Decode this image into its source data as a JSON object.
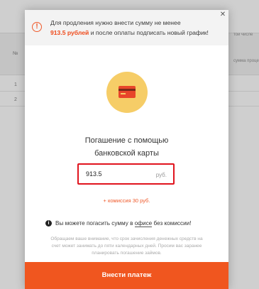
{
  "background": {
    "table_col_no": "№",
    "rows": [
      "1",
      "2"
    ],
    "col_text_1": "той числе",
    "col_text_2": "сумма процентов"
  },
  "notice": {
    "text_prefix": "Для продления нужно внести сумму не менее",
    "amount": "913.5 рублей",
    "text_suffix": " и после оплаты подписать новый график!"
  },
  "card_icon": "credit-card-icon",
  "title_line1": "Погашение с помощью",
  "title_line2": "банковской карты",
  "amount_input": {
    "value": "913.5",
    "currency": "руб."
  },
  "commission": "+ комиссия 30 руб.",
  "info": {
    "prefix": "Вы можете погасить сумму в ",
    "link": "офисе",
    "suffix": " без комиссии!"
  },
  "fine_print": "Обращаем ваше внимание, что срок зачисления денежных средств на счет может занимать до пяти календарных дней. Просим вас заранее планировать погашение займов.",
  "pay_button": "Внести платеж",
  "colors": {
    "accent": "#f0561f",
    "highlight_border": "#e0141e",
    "card_circle": "#f6cd67"
  }
}
